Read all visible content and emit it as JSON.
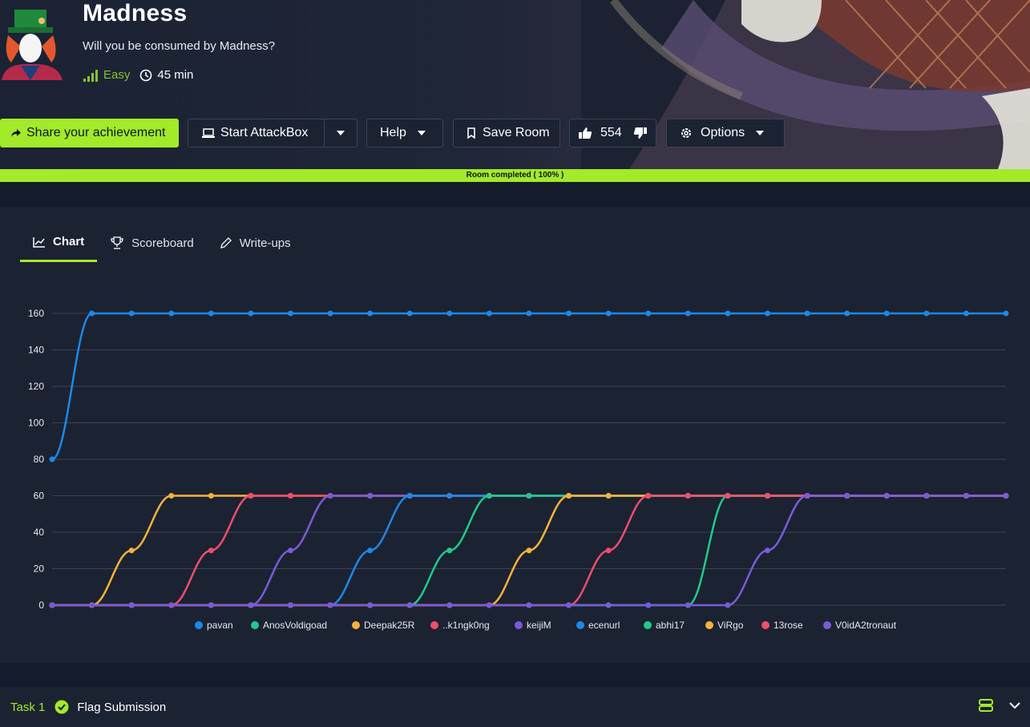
{
  "room": {
    "title": "Madness",
    "subtitle": "Will you be consumed by Madness?",
    "difficulty": "Easy",
    "duration": "45 min"
  },
  "toolbar": {
    "share_label": "Share your achievement",
    "attackbox_label": "Start AttackBox",
    "help_label": "Help",
    "save_label": "Save Room",
    "likes": "554",
    "options_label": "Options"
  },
  "progress": {
    "text": "Room completed ( 100% )",
    "fraction": 1.0
  },
  "tabs": [
    {
      "label": "Chart"
    },
    {
      "label": "Scoreboard"
    },
    {
      "label": "Write-ups"
    }
  ],
  "task": {
    "label": "Task 1",
    "title": "Flag Submission"
  },
  "colors": {
    "accent": "#a3ea2a",
    "difficulty_easy": "#86c232"
  },
  "chart_data": {
    "type": "line",
    "x": [
      1,
      2,
      3,
      4,
      5,
      6,
      7,
      8,
      9,
      10,
      11,
      12,
      13,
      14,
      15,
      16,
      17,
      18,
      19,
      20,
      21,
      22,
      23,
      24,
      25
    ],
    "ylim": [
      0,
      160
    ],
    "yticks": [
      0,
      20,
      40,
      60,
      80,
      100,
      120,
      140,
      160
    ],
    "grid": true,
    "legend": "bottom",
    "series": [
      {
        "name": "pavan",
        "color": "#1e88e5",
        "values": [
          80,
          160,
          160,
          160,
          160,
          160,
          160,
          160,
          160,
          160,
          160,
          160,
          160,
          160,
          160,
          160,
          160,
          160,
          160,
          160,
          160,
          160,
          160,
          160,
          160
        ]
      },
      {
        "name": "AnosVoldigoad",
        "color": "#22c98a",
        "values": [
          0,
          0,
          0,
          0,
          0,
          0,
          0,
          0,
          0,
          0,
          0,
          0,
          0,
          0,
          0,
          0,
          0,
          60,
          60,
          60,
          60,
          60,
          60,
          60,
          60
        ]
      },
      {
        "name": "Deepak25R",
        "color": "#f7b23b",
        "values": [
          0,
          0,
          30,
          60,
          60,
          60,
          60,
          60,
          60,
          60,
          60,
          60,
          60,
          60,
          60,
          60,
          60,
          60,
          60,
          60,
          60,
          60,
          60,
          60,
          60
        ]
      },
      {
        "name": "..k1ngk0ng",
        "color": "#ef4d6c",
        "values": [
          0,
          0,
          0,
          0,
          30,
          60,
          60,
          60,
          60,
          60,
          60,
          60,
          60,
          60,
          60,
          60,
          60,
          60,
          60,
          60,
          60,
          60,
          60,
          60,
          60
        ]
      },
      {
        "name": "keijiM",
        "color": "#7b5ad8",
        "values": [
          0,
          0,
          0,
          0,
          0,
          0,
          30,
          60,
          60,
          60,
          60,
          60,
          60,
          60,
          60,
          60,
          60,
          60,
          60,
          60,
          60,
          60,
          60,
          60,
          60
        ]
      },
      {
        "name": "ecenurl",
        "color": "#1e88e5",
        "values": [
          0,
          0,
          0,
          0,
          0,
          0,
          0,
          0,
          30,
          60,
          60,
          60,
          60,
          60,
          60,
          60,
          60,
          60,
          60,
          60,
          60,
          60,
          60,
          60,
          60
        ]
      },
      {
        "name": "abhi17",
        "color": "#22c98a",
        "values": [
          0,
          0,
          0,
          0,
          0,
          0,
          0,
          0,
          0,
          0,
          30,
          60,
          60,
          60,
          60,
          60,
          60,
          60,
          60,
          60,
          60,
          60,
          60,
          60,
          60
        ]
      },
      {
        "name": "ViRgo",
        "color": "#f7b23b",
        "values": [
          0,
          0,
          0,
          0,
          0,
          0,
          0,
          0,
          0,
          0,
          0,
          0,
          30,
          60,
          60,
          60,
          60,
          60,
          60,
          60,
          60,
          60,
          60,
          60,
          60
        ]
      },
      {
        "name": "13rose",
        "color": "#ef4d6c",
        "values": [
          0,
          0,
          0,
          0,
          0,
          0,
          0,
          0,
          0,
          0,
          0,
          0,
          0,
          0,
          30,
          60,
          60,
          60,
          60,
          60,
          60,
          60,
          60,
          60,
          60
        ]
      },
      {
        "name": "V0idA2tronaut",
        "color": "#7b5ad8",
        "values": [
          0,
          0,
          0,
          0,
          0,
          0,
          0,
          0,
          0,
          0,
          0,
          0,
          0,
          0,
          0,
          0,
          0,
          0,
          30,
          60,
          60,
          60,
          60,
          60,
          60
        ]
      }
    ]
  }
}
